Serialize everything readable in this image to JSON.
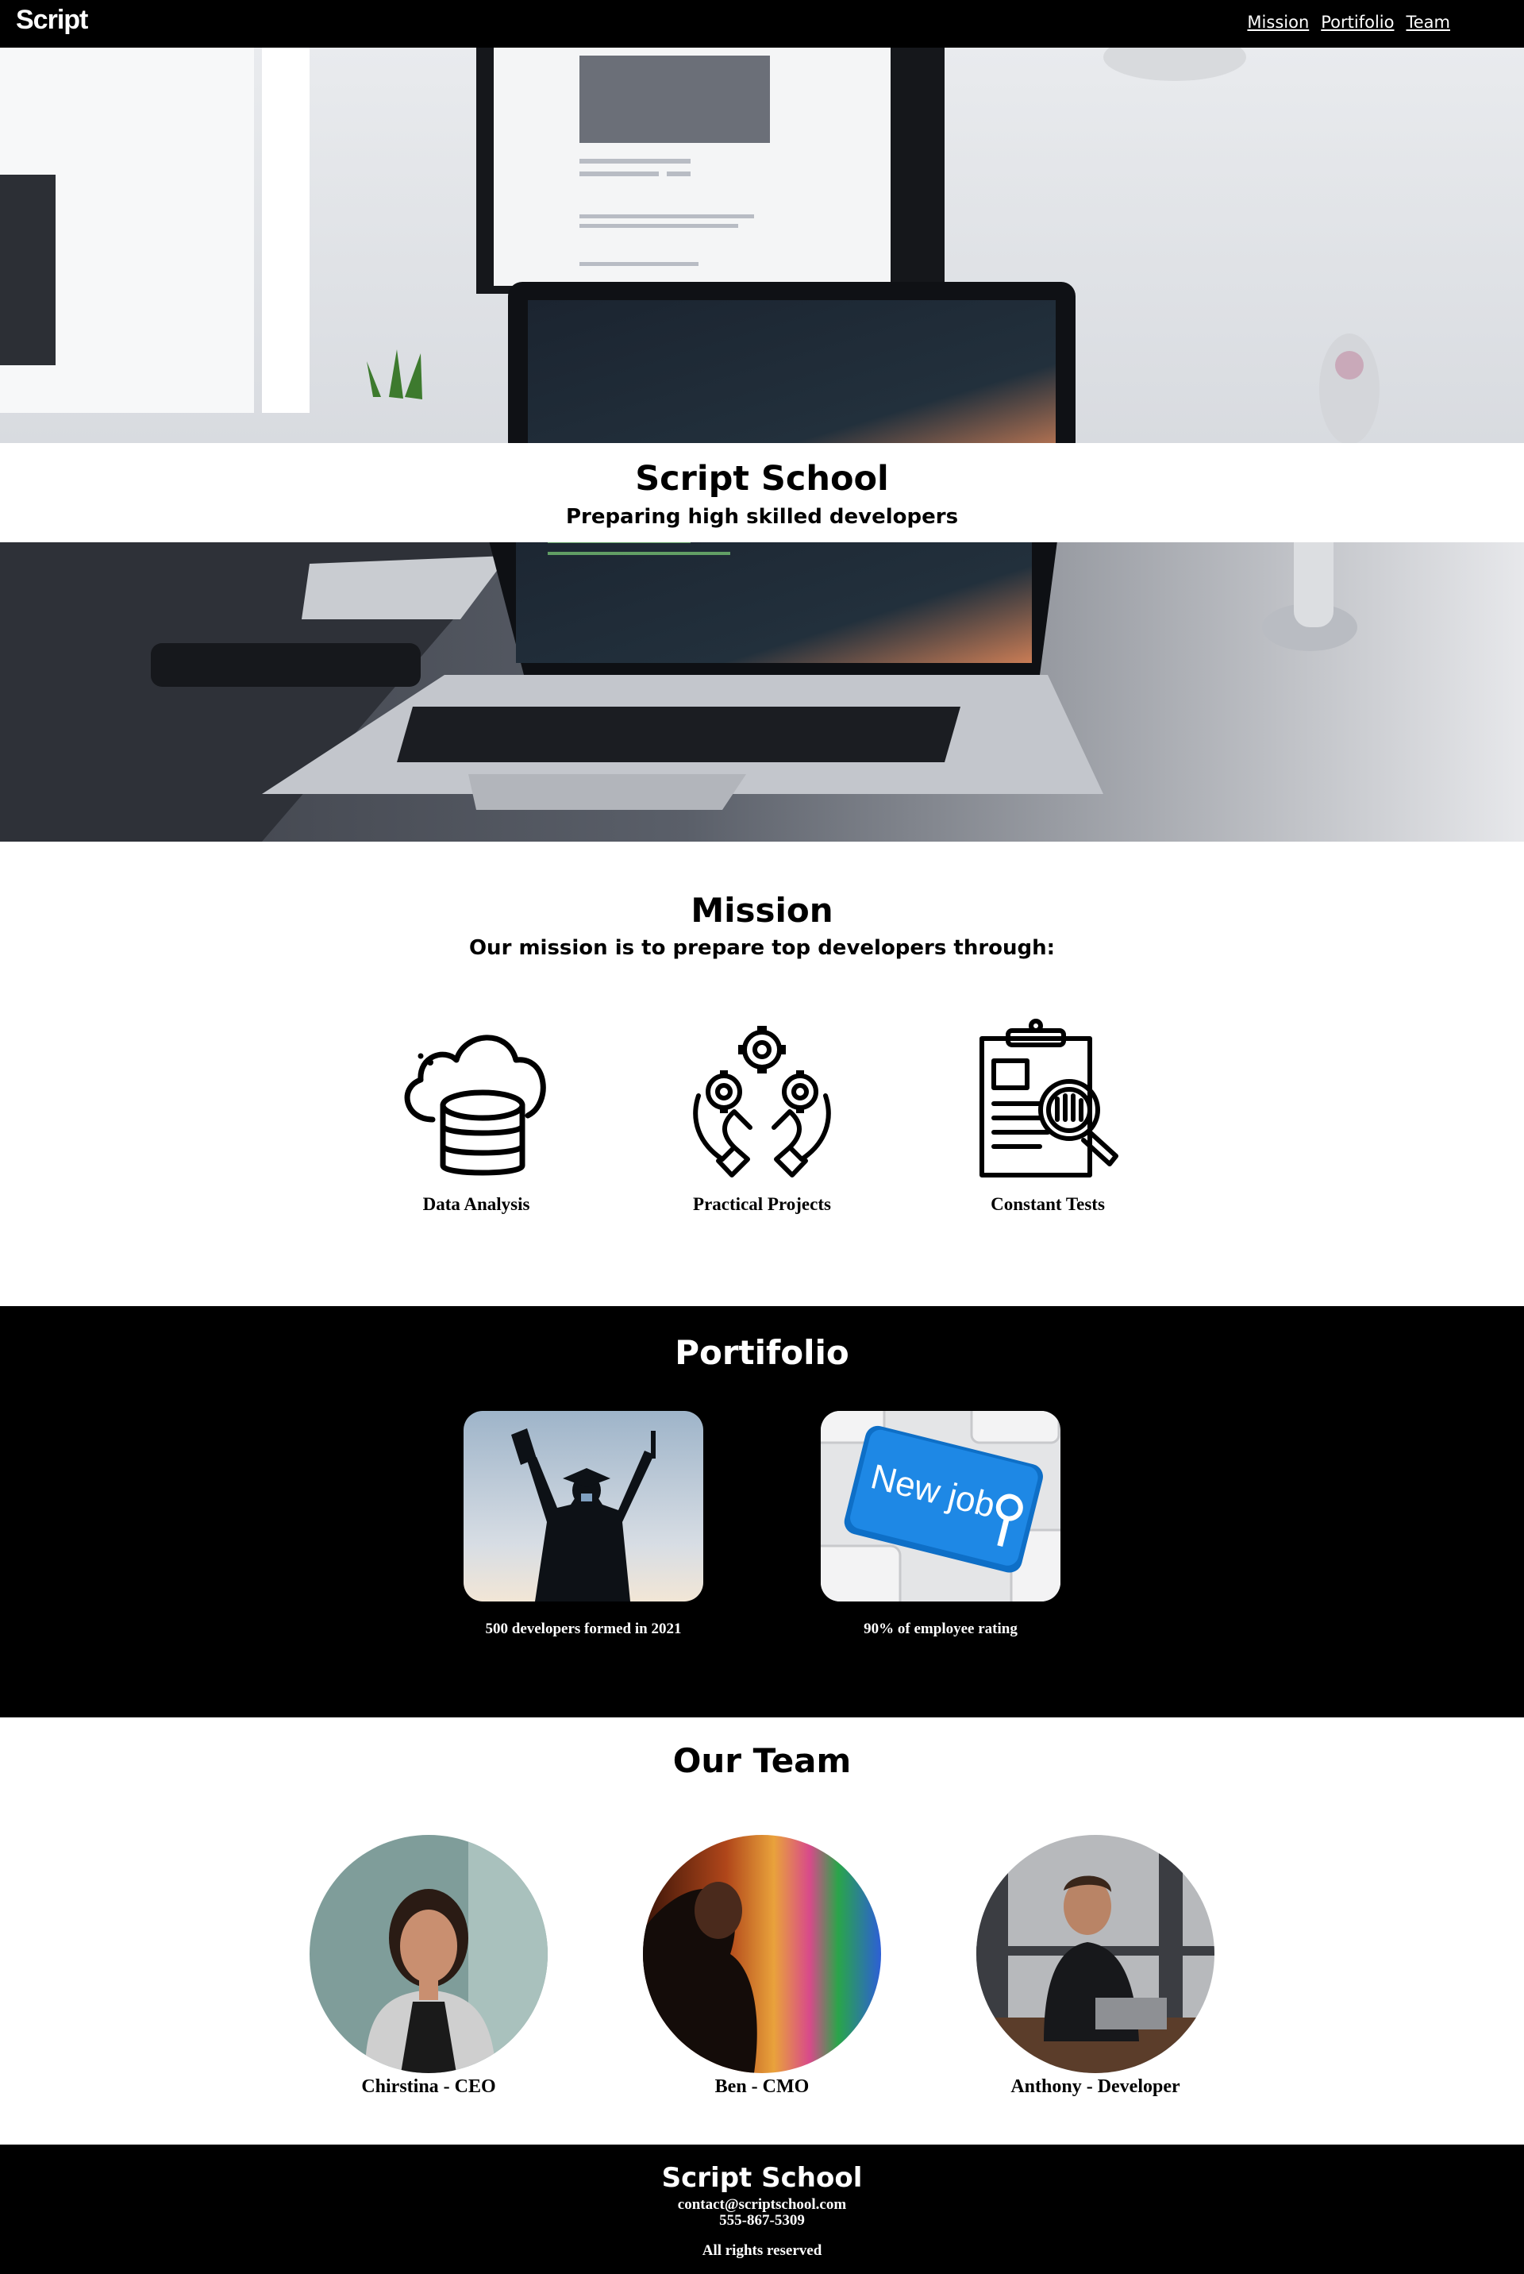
{
  "header": {
    "logo": "Script",
    "nav": [
      {
        "label": "Mission"
      },
      {
        "label": "Portifolio"
      },
      {
        "label": "Team"
      }
    ]
  },
  "hero": {
    "title": "Script School",
    "subtitle": "Preparing high skilled developers",
    "image": "laptop-on-desk-photo"
  },
  "mission": {
    "title": "Mission",
    "subtitle": "Our mission is to prepare top developers through:",
    "items": [
      {
        "label": "Data Analysis",
        "icon": "cloud-database-icon"
      },
      {
        "label": "Practical Projects",
        "icon": "hands-gears-icon"
      },
      {
        "label": "Constant Tests",
        "icon": "clipboard-magnifier-icon"
      }
    ]
  },
  "portfolio": {
    "title": "Portifolio",
    "items": [
      {
        "caption": "500 developers formed in 2021",
        "image": "graduate-silhouette-photo"
      },
      {
        "caption": "90% of employee rating",
        "image": "new-job-key-photo",
        "key_text": "New job"
      }
    ]
  },
  "team": {
    "title": "Our Team",
    "members": [
      {
        "name": "Chirstina - CEO"
      },
      {
        "name": "Ben - CMO"
      },
      {
        "name": "Anthony - Developer"
      }
    ]
  },
  "footer": {
    "title": "Script School",
    "email": "contact@scriptschool.com",
    "phone": "555-867-5309",
    "rights": "All rights reserved"
  },
  "colors": {
    "header_bg": "#000000",
    "footer_bg": "#000000",
    "portfolio_bg": "#000000",
    "text_light": "#ffffff",
    "key_blue": "#1e88e5"
  }
}
